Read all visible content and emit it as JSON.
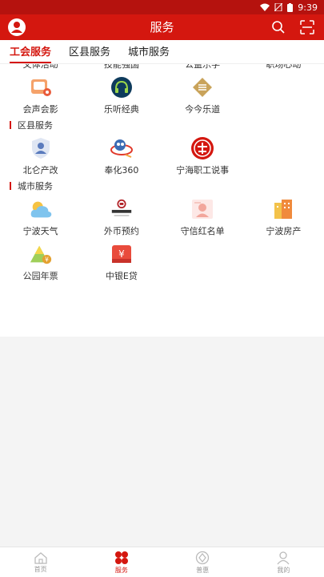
{
  "status_bar": {
    "time": "9:39"
  },
  "app_bar": {
    "title": "服务"
  },
  "tabs": [
    {
      "label": "工会服务",
      "active": true
    },
    {
      "label": "区县服务",
      "active": false
    },
    {
      "label": "城市服务",
      "active": false
    }
  ],
  "cut_row": [
    "文体活动",
    "技能强国",
    "公益乐学",
    "职场心动"
  ],
  "union_services": [
    {
      "label": "会声会影",
      "icon": "video-icon"
    },
    {
      "label": "乐听经典",
      "icon": "headphones-icon"
    },
    {
      "label": "今今乐道",
      "icon": "book-icon"
    }
  ],
  "county_section": {
    "title": "区县服务"
  },
  "county_services": [
    {
      "label": "北仑产改",
      "icon": "person-shield-icon"
    },
    {
      "label": "奉化360",
      "icon": "fenghua-360-icon"
    },
    {
      "label": "宁海职工说事",
      "icon": "ninghai-logo-icon"
    }
  ],
  "city_section": {
    "title": "城市服务"
  },
  "city_services": [
    {
      "label": "宁波天气",
      "icon": "weather-icon"
    },
    {
      "label": "外币预约",
      "icon": "bank-of-china-icon"
    },
    {
      "label": "守信红名单",
      "icon": "credit-list-icon"
    },
    {
      "label": "宁波房产",
      "icon": "buildings-icon"
    },
    {
      "label": "公园年票",
      "icon": "park-ticket-icon"
    },
    {
      "label": "中银E贷",
      "icon": "loan-icon"
    }
  ],
  "bottom_nav": [
    {
      "label": "首页",
      "icon": "home-icon",
      "active": false
    },
    {
      "label": "服务",
      "icon": "services-icon",
      "active": true
    },
    {
      "label": "普惠",
      "icon": "benefits-icon",
      "active": false
    },
    {
      "label": "我的",
      "icon": "profile-icon",
      "active": false
    }
  ],
  "colors": {
    "brand": "#d4170f",
    "status_bar": "#b5120e"
  }
}
